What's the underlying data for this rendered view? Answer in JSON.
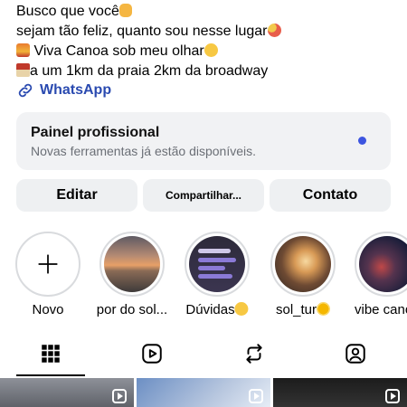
{
  "bio": {
    "line1": "Busco que você",
    "line2": "sejam tão feliz, quanto sou nesse lugar",
    "line3": " Viva Canoa sob meu olhar",
    "line4": "a um 1km da praia 2km da broadway"
  },
  "link": {
    "label": "WhatsApp",
    "icon": "link-icon"
  },
  "panel": {
    "title": "Painel profissional",
    "subtitle": "Novas ferramentas já estão disponíveis.",
    "dot_color": "#3d55e0"
  },
  "buttons": {
    "edit": "Editar",
    "share": "Compartilhar...",
    "contact": "Contato"
  },
  "highlights": [
    {
      "label": "Novo"
    },
    {
      "label": "por do sol..."
    },
    {
      "label": "Dúvidas"
    },
    {
      "label": "sol_tur"
    },
    {
      "label": "vibe canoa"
    }
  ],
  "tabs": [
    "grid-icon",
    "reels-icon",
    "reposts-icon",
    "tagged-icon"
  ],
  "colors": {
    "link": "#2a4ab0",
    "panel_bg": "#f1f2f4",
    "button_bg": "#eef0f2"
  }
}
